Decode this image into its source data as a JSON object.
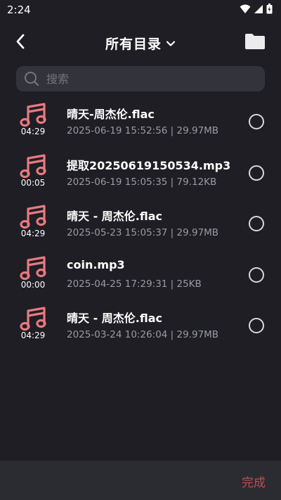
{
  "status_bar": {
    "time": "2:24"
  },
  "header": {
    "title": "所有目录"
  },
  "search": {
    "placeholder": "搜索"
  },
  "files": [
    {
      "name": "晴天-周杰伦.flac",
      "duration": "04:29",
      "meta": "2025-06-19 15:52:56 | 29.97MB"
    },
    {
      "name": "提取20250619150534.mp3",
      "duration": "00:05",
      "meta": "2025-06-19 15:05:35 | 79.12KB"
    },
    {
      "name": "晴天 - 周杰伦.flac",
      "duration": "04:29",
      "meta": "2025-05-23 15:05:37 | 29.97MB"
    },
    {
      "name": "coin.mp3",
      "duration": "00:00",
      "meta": "2025-04-25 17:29:31 | 25KB"
    },
    {
      "name": "晴天 - 周杰伦.flac",
      "duration": "04:29",
      "meta": "2025-03-24 10:26:04 | 29.97MB"
    }
  ],
  "footer": {
    "done_label": "完成"
  },
  "colors": {
    "background": "#1e1e24",
    "search_bg": "#33343b",
    "bottom_bar": "#2b2c31",
    "music_icon": "#e77a80",
    "done_text": "#b95050"
  },
  "icons": {
    "back": "chevron-left-icon",
    "title_dropdown": "chevron-down-icon",
    "folder": "folder-icon",
    "search": "search-icon",
    "file": "music-note-icon",
    "select": "radio-icon"
  }
}
